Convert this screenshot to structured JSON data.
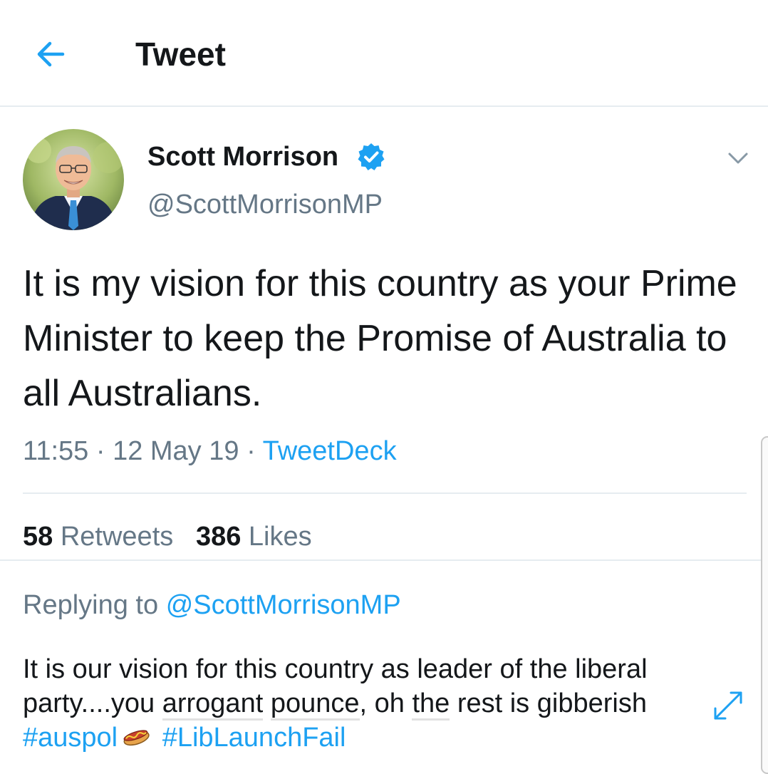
{
  "header": {
    "back_icon": "arrow-left-icon",
    "title": "Tweet",
    "accent_color": "#1da1f2"
  },
  "tweet": {
    "author_name": "Scott Morrison",
    "verified_icon": "verified-badge-icon",
    "handle": "@ScottMorrisonMP",
    "menu_icon": "chevron-down-icon",
    "text": "It is my vision for this country as your Prime Minister to keep the Promise of Australia to all Australians.",
    "time": "11:55",
    "date": "12 May 19",
    "separator": "·",
    "source": "TweetDeck",
    "retweets_count": "58",
    "retweets_label": "Retweets",
    "likes_count": "386",
    "likes_label": "Likes"
  },
  "reply": {
    "replying_prefix": "Replying to",
    "replying_handle": "@ScottMorrisonMP",
    "text_part1": "It is our vision for this country as leader of the liberal party....you ",
    "underlined1": "arrogant",
    "space1": " ",
    "underlined2": "pounce",
    "text_part2": ", oh ",
    "underlined3": "the",
    "text_part3": " rest is gibberish ",
    "hashtag1": "#auspol",
    "emoji_icon": "hotdog-emoji-icon",
    "hashtag2": "#LibLaunchFail",
    "expand_icon": "expand-arrows-icon"
  }
}
